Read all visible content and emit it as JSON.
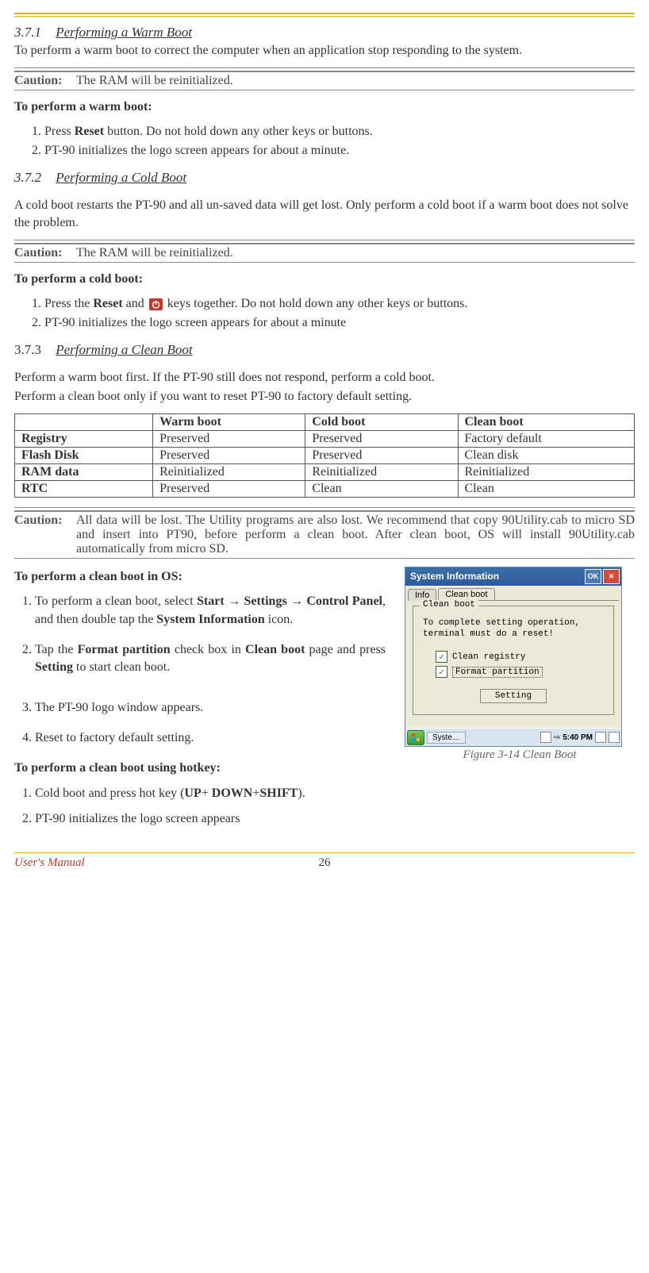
{
  "sections": {
    "s371": {
      "num": "3.7.1",
      "title": "Performing a Warm Boot"
    },
    "s372": {
      "num": "3.7.2",
      "title": "Performing a Cold Boot"
    },
    "s373": {
      "num": "3.7.3",
      "title": "Performing a Clean Boot"
    }
  },
  "para": {
    "warm_intro": "To perform a warm boot to correct the computer when an application stop responding to the system.",
    "cold_intro": "A cold boot restarts the PT-90 and all un-saved data will get lost. Only perform a cold boot if a warm boot does not solve the problem.",
    "clean_intro1": "Perform a warm boot first. If the PT-90 still does not respond, perform a cold boot.",
    "clean_intro2": "Perform a clean boot only if you want to reset PT-90 to factory default setting."
  },
  "cautions": {
    "label": "Caution:",
    "ram1": "The RAM will be reinitialized.",
    "ram2": "The RAM will be reinitialized.",
    "clean": "All data will be lost. The Utility programs are also lost. We recommend that copy 90Utility.cab to micro SD and insert into PT90, before perform a clean boot. After clean boot, OS will install 90Utility.cab automatically from micro SD."
  },
  "headings": {
    "warm_steps": "To perform a warm boot:",
    "cold_steps": "To perform a cold boot:",
    "clean_os": "To perform a clean boot in OS:",
    "clean_hotkey": "To perform a clean boot using hotkey:"
  },
  "warm_steps": {
    "s1a": "Press ",
    "s1b": "Reset",
    "s1c": " button. Do not hold down any other keys or buttons.",
    "s2": "PT-90 initializes the logo screen appears for about a minute."
  },
  "cold_steps": {
    "s1a": "Press the ",
    "s1b": "Reset",
    "s1c": " and ",
    "s1d": " keys together. Do not hold down any other keys or buttons.",
    "s2": "PT-90 initializes the logo screen appears for about a minute"
  },
  "table": {
    "h_blank": "",
    "h_warm": "Warm boot",
    "h_cold": "Cold boot",
    "h_clean": "Clean boot",
    "r1": "Registry",
    "r1a": "Preserved",
    "r1b": "Preserved",
    "r1c": "Factory default",
    "r2": "Flash Disk",
    "r2a": "Preserved",
    "r2b": "Preserved",
    "r2c": "Clean disk",
    "r3": "RAM data",
    "r3a": "Reinitialized",
    "r3b": "Reinitialized",
    "r3c": "Reinitialized",
    "r4": "RTC",
    "r4a": "Preserved",
    "r4b": "Clean",
    "r4c": "Clean"
  },
  "clean_os_steps": {
    "s1a": "To perform a clean boot, select ",
    "s1b": "Start",
    "s1c": " → ",
    "s1d": "Settings",
    "s1e": " → ",
    "s1f": "Control Panel",
    "s1g": ", and then double tap the ",
    "s1h": "System Information",
    "s1i": " icon.",
    "s2a": "Tap the ",
    "s2b": "Format partition",
    "s2c": " check box in ",
    "s2d": "Clean boot",
    "s2e": " page and press ",
    "s2f": "Setting",
    "s2g": " to start clean boot.",
    "s3": "The PT-90 logo window appears.",
    "s4": "Reset to factory default setting."
  },
  "clean_hotkey_steps": {
    "s1a": "Cold boot and press hot key (",
    "s1b": "UP",
    "s1c": "+ ",
    "s1d": "DOWN",
    "s1e": "+",
    "s1f": "SHIFT",
    "s1g": ").",
    "s2": "PT-90 initializes the logo screen appears"
  },
  "figure": {
    "caption": "Figure 3-14 Clean Boot",
    "title": "System Information",
    "ok": "OK",
    "tab_info": "Info",
    "tab_clean": "Clean boot",
    "legend": "Clean boot",
    "msg": "To complete setting operation, terminal must do a reset!",
    "chk1": "Clean registry",
    "chk2": "Format partition",
    "btn": "Setting",
    "task": "Syste…",
    "clock": "5:40 PM"
  },
  "footer": {
    "manual": "User's Manual",
    "page": "26"
  }
}
